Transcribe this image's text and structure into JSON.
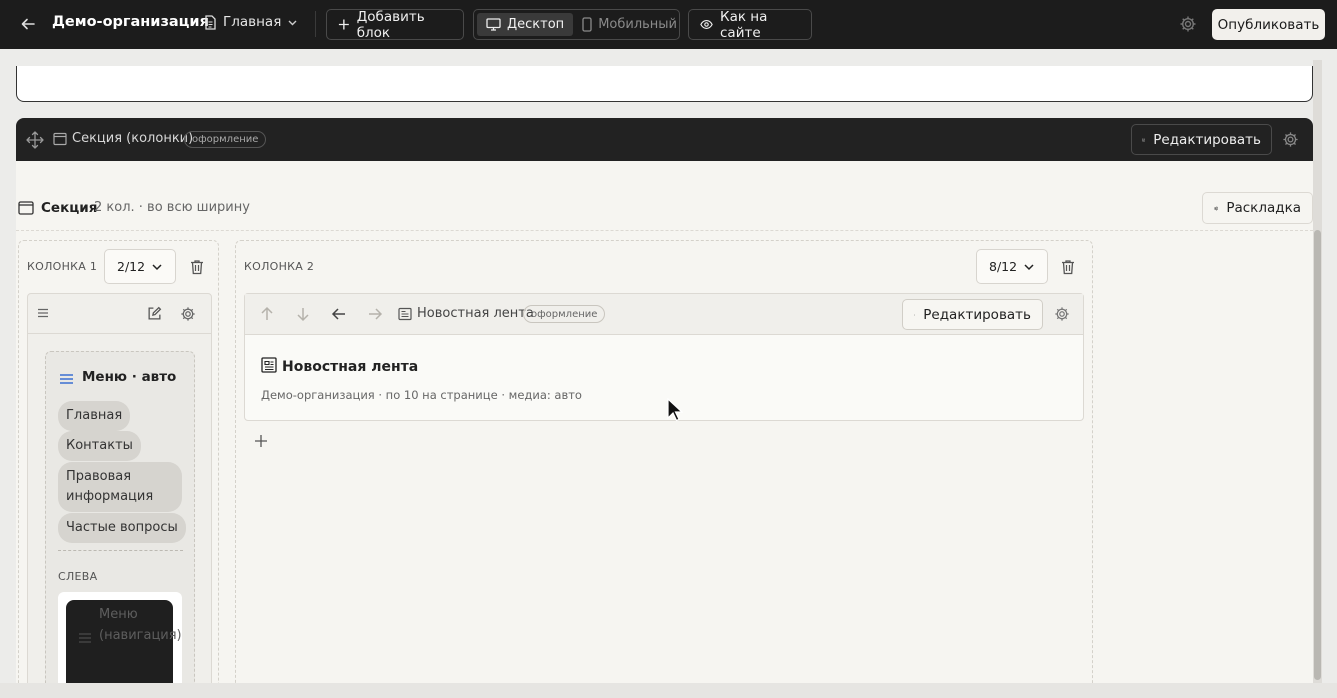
{
  "topbar": {
    "org_name": "Демо-организация",
    "page_selector": "Главная",
    "add_block": "Добавить блок",
    "device_desktop": "Десктоп",
    "device_mobile": "Мобильный",
    "preview": "Как на сайте",
    "publish": "Опубликовать"
  },
  "section_block": {
    "title": "Секция (колонки)",
    "badge": "оформление",
    "edit": "Редактировать"
  },
  "section": {
    "title": "Секция",
    "info": "2 кол. · во всю ширину",
    "layout_button": "Раскладка"
  },
  "column1": {
    "label": "КОЛОНКА 1",
    "width": "2/12",
    "menu": {
      "title": "Меню · авто",
      "items": [
        "Главная",
        "Контакты",
        "Правовая информация",
        "Частые вопросы"
      ],
      "side_label": "СЛЕВА",
      "preview_text": "Меню (навигация)"
    }
  },
  "column2": {
    "label": "КОЛОНКА 2",
    "width": "8/12",
    "news": {
      "tag_title": "Новостная лента",
      "badge": "оформление",
      "edit": "Редактировать",
      "title": "Новостная лента",
      "meta": "Демо-организация · по 10 на странице · медиа: авто"
    }
  },
  "colors": {
    "topbar_bg": "#1c1c1c",
    "canvas_bg": "#f6f5f1",
    "accent_menu_icon": "#3b6fd1"
  }
}
